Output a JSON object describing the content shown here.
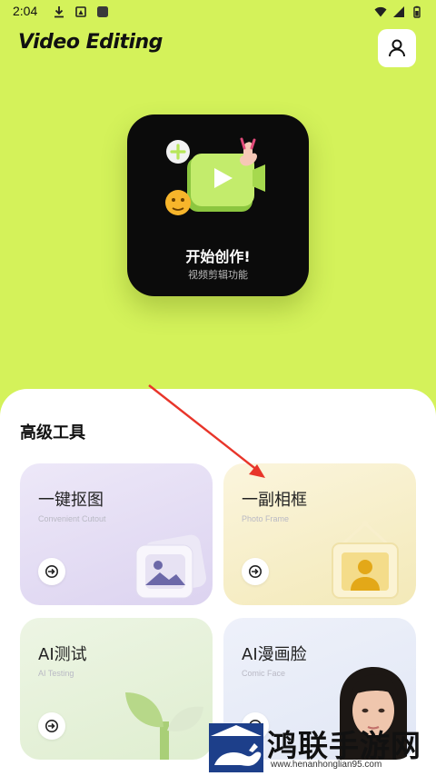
{
  "status_bar": {
    "time": "2:04",
    "left_icons": [
      "download-icon",
      "storage-icon",
      "app-square-icon"
    ],
    "right_icons": [
      "wifi-icon",
      "signal-icon",
      "battery-icon"
    ]
  },
  "header": {
    "title": "Video Editing",
    "profile_icon": "person-icon"
  },
  "hero": {
    "title": "开始创作!",
    "subtitle": "视频剪辑功能"
  },
  "tools": {
    "section_title": "高级工具",
    "items": [
      {
        "title": "一键抠图",
        "subtitle": "Convenient Cutout",
        "go_icon": "arrow-enter-icon"
      },
      {
        "title": "一副相框",
        "subtitle": "Photo Frame",
        "go_icon": "arrow-enter-icon"
      },
      {
        "title": "AI测试",
        "subtitle": "AI Testing",
        "go_icon": "arrow-enter-icon"
      },
      {
        "title": "AI漫画脸",
        "subtitle": "Comic Face",
        "go_icon": "arrow-enter-icon"
      }
    ]
  },
  "watermark": {
    "text": "鸿联手游网",
    "url": "www.henanhonglian95.com"
  },
  "colors": {
    "background": "#d4f25a",
    "hero_card": "#0b0b0b",
    "accent_green": "#b8e65a",
    "annotation_arrow": "#e8352a"
  }
}
